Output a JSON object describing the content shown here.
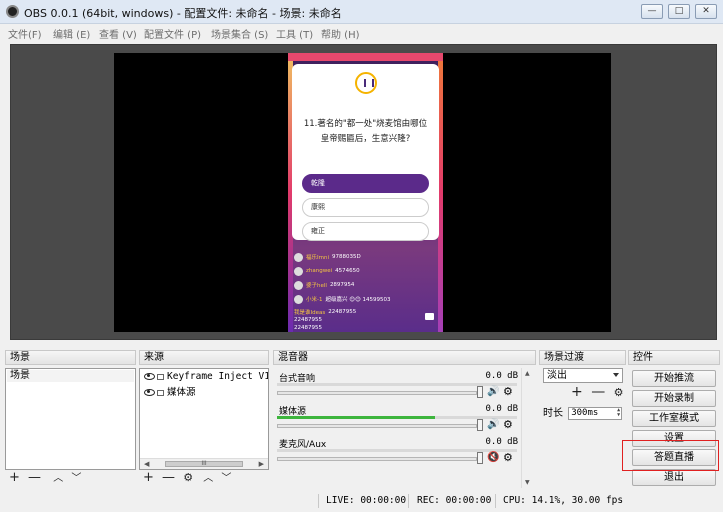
{
  "window": {
    "title": "OBS 0.0.1 (64bit, windows) - 配置文件: 未命名 - 场景: 未命名",
    "min": "—",
    "max": "□",
    "close": "✕"
  },
  "menu": [
    "文件(F)",
    "编辑 (E)",
    "查看 (V)",
    "配置文件 (P)",
    "场景集合 (S)",
    "工具 (T)",
    "帮助 (H)"
  ],
  "preview": {
    "question": "11.著名的\"都一处\"烧麦馆由哪位皇帝赐匾后，生意兴隆?",
    "options": [
      "乾隆",
      "康熙",
      "雍正"
    ],
    "comments": [
      {
        "user": "福乐Imni",
        "text": "9788035D"
      },
      {
        "user": "zhangwei",
        "text": "4574650"
      },
      {
        "user": "婆子hell",
        "text": "2897954"
      },
      {
        "user": "小米-1",
        "text": "超级嘉兴 😊😊 14599503"
      },
      {
        "user": "我是谁Ideas",
        "text": "22487955"
      },
      {
        "user": "",
        "text": "22487955"
      },
      {
        "user": "",
        "text": "22487955"
      },
      {
        "user": "",
        "text": "22487955"
      }
    ]
  },
  "scenes": {
    "header": "场景",
    "items": [
      "场景"
    ],
    "add": "+",
    "remove": "—",
    "up": "︿",
    "down": "﹀"
  },
  "sources": {
    "header": "来源",
    "items": [
      "Keyframe Inject V1",
      "媒体源"
    ],
    "scroll_left": "◀",
    "scroll_thumb": "III",
    "scroll_right": "▶",
    "add": "+",
    "remove": "—",
    "settings": "⚙",
    "up": "︿",
    "down": "﹀"
  },
  "mixer": {
    "header": "混音器",
    "channels": [
      {
        "name": "台式音响",
        "db": "0.0 dB",
        "level": 0,
        "speaker": "🔊",
        "gear": "⚙"
      },
      {
        "name": "媒体源",
        "db": "0.0 dB",
        "level": 0.66,
        "speaker": "🔊",
        "gear": "⚙"
      },
      {
        "name": "麦克风/Aux",
        "db": "0.0 dB",
        "level": 0,
        "speaker": "🔇",
        "gear": "⚙"
      }
    ],
    "scroll_up": "▲",
    "scroll_down": "▼"
  },
  "transitions": {
    "header": "场景过渡",
    "selected": "淡出",
    "add": "+",
    "remove": "—",
    "settings": "⚙",
    "duration_label": "时长",
    "duration_value": "300ms"
  },
  "controls": {
    "header": "控件",
    "buttons": [
      "开始推流",
      "开始录制",
      "工作室模式",
      "设置",
      "答题直播",
      "退出"
    ]
  },
  "status": {
    "live": "LIVE: 00:00:00",
    "rec": "REC: 00:00:00",
    "cpu": "CPU: 14.1%, 30.00 fps"
  },
  "colors": {
    "highlight_box": "#e02020",
    "selected_option": "#5b2a8a"
  }
}
